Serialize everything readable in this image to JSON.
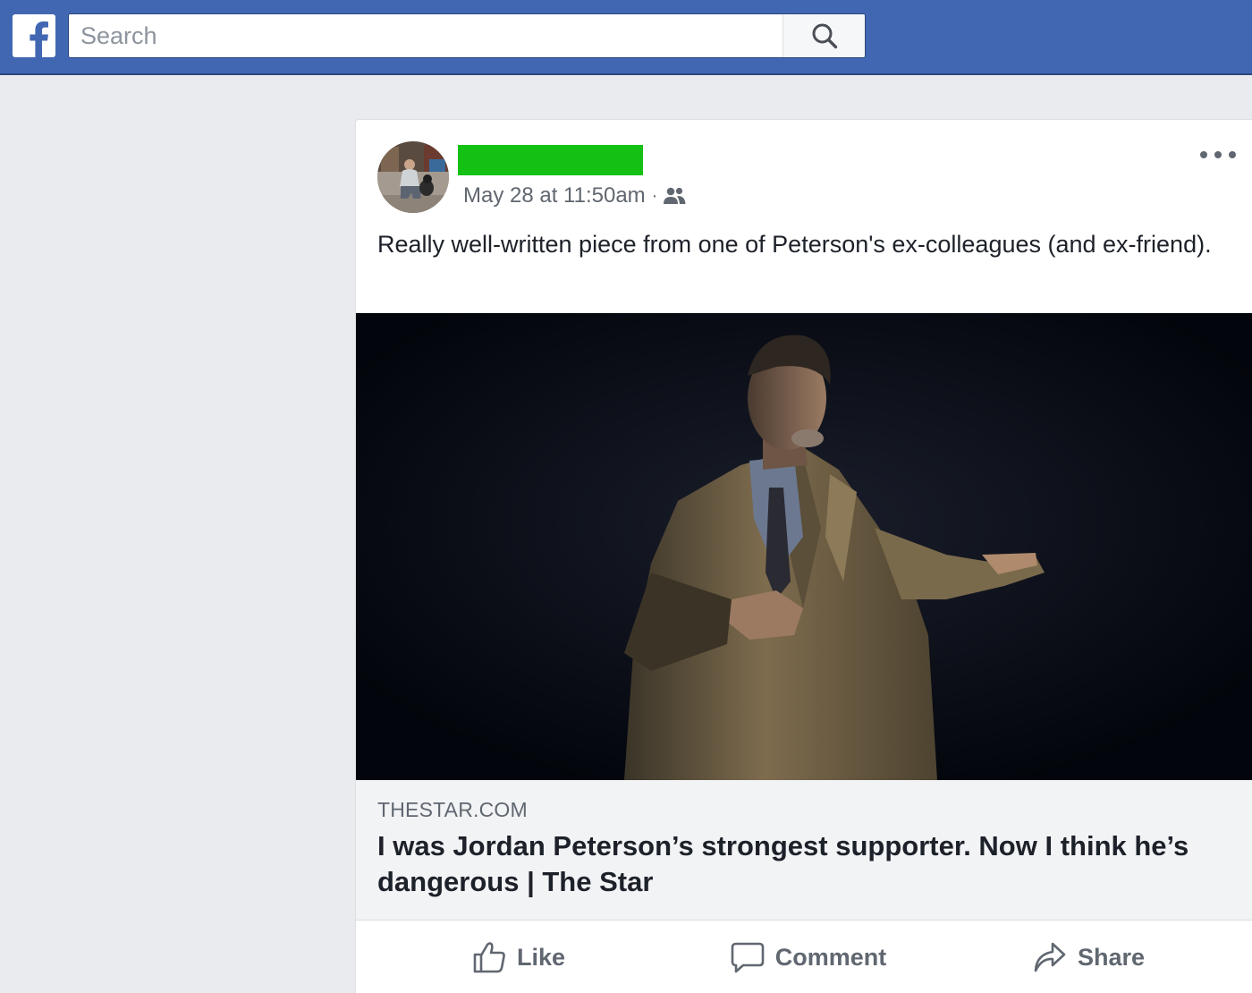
{
  "header": {
    "logo": "facebook-f-icon",
    "search": {
      "placeholder": "Search",
      "value": "",
      "button_icon": "magnifier-icon"
    }
  },
  "post": {
    "author": {
      "name_redacted": true,
      "redaction_color": "#14c014",
      "avatar": "profile-photo"
    },
    "timestamp": "May 28 at 11:50am",
    "separator": "·",
    "audience_icon": "friends-icon",
    "menu_icon": "ellipsis-icon",
    "text": "Really well-written piece from one of Peterson's ex-colleagues (and ex-friend).",
    "link": {
      "image": "speaker-on-stage-photo",
      "domain": "THESTAR.COM",
      "title": "I was Jordan Peterson’s strongest supporter. Now I think he’s dangerous | The Star"
    },
    "actions": {
      "like": {
        "label": "Like",
        "icon": "thumbs-up-icon"
      },
      "comment": {
        "label": "Comment",
        "icon": "speech-bubble-icon"
      },
      "share": {
        "label": "Share",
        "icon": "share-arrow-icon"
      }
    }
  },
  "colors": {
    "brand": "#4267b2",
    "page_bg": "#e9ebee",
    "secondary_text": "#606770"
  }
}
